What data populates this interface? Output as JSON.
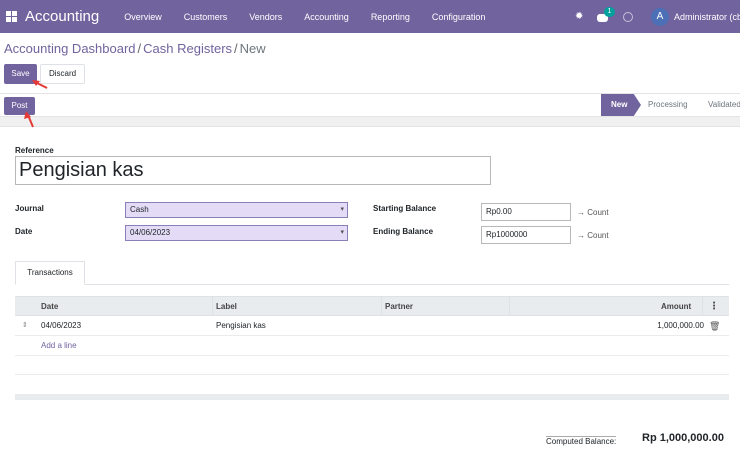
{
  "navbar": {
    "brand": "Accounting",
    "menu": [
      "Overview",
      "Customers",
      "Vendors",
      "Accounting",
      "Reporting",
      "Configuration"
    ],
    "chat_badge": "1",
    "avatar_letter": "A",
    "user": "Administrator (cb"
  },
  "breadcrumb": {
    "item1": "Accounting Dashboard",
    "item2": "Cash Registers",
    "current": "New"
  },
  "buttons": {
    "save": "Save",
    "discard": "Discard",
    "post": "Post"
  },
  "stages": {
    "new": "New",
    "processing": "Processing",
    "validated": "Validated"
  },
  "form": {
    "reference_label": "Reference",
    "reference_value": "Pengisian kas",
    "journal_label": "Journal",
    "journal_value": "Cash",
    "date_label": "Date",
    "date_value": "04/06/2023",
    "starting_balance_label": "Starting Balance",
    "starting_balance_value": "Rp0.00",
    "ending_balance_label": "Ending Balance",
    "ending_balance_value": "Rp1000000",
    "count_label": "Count"
  },
  "tabs": {
    "transactions": "Transactions"
  },
  "table": {
    "headers": {
      "date": "Date",
      "label": "Label",
      "partner": "Partner",
      "amount": "Amount"
    },
    "rows": [
      {
        "date": "04/06/2023",
        "label": "Pengisian kas",
        "partner": "",
        "amount": "1,000,000.00"
      }
    ],
    "add_line": "Add a line"
  },
  "computed": {
    "label": "Computed Balance:",
    "value": "Rp 1,000,000.00"
  },
  "colors": {
    "brand": "#71639e",
    "select_bg": "#e4dcf7",
    "annotation": "#e53935"
  }
}
